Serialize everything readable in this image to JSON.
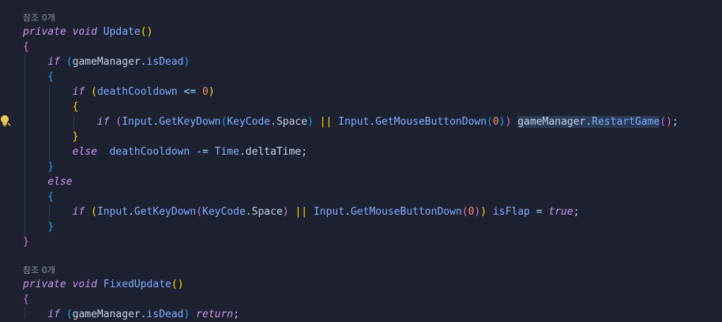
{
  "editor": {
    "references": [
      "참조 0개",
      "참조 0개"
    ],
    "tokens": {
      "private": "private",
      "void": "void",
      "if": "if",
      "else": "else",
      "return": "return",
      "true": "true",
      "update": "Update",
      "fixed_update": "FixedUpdate",
      "game_manager": "gameManager",
      "is_dead": "isDead",
      "death_cooldown": "deathCooldown",
      "input": "Input",
      "get_key_down": "GetKeyDown",
      "key_code": "KeyCode",
      "space": "Space",
      "get_mouse_button_down": "GetMouseButtonDown",
      "restart_game": "RestartGame",
      "time": "Time",
      "delta_time": "deltaTime",
      "is_flap": "isFlap",
      "zero": "0",
      "dot": ".",
      "semicolon": ";",
      "lparen": "(",
      "rparen": ")",
      "lbrace": "{",
      "rbrace": "}",
      "lte": "<=",
      "minus_eq": "-=",
      "or": "||",
      "eq": "="
    },
    "lightbulb_icon": "lightbulb-icon",
    "colors": {
      "background": "#1e2230",
      "keyword": "#c792ea",
      "function": "#82aaff",
      "number": "#f78c6c",
      "bracket_gold": "#ffd700",
      "bracket_purple": "#da70d6",
      "bracket_blue": "#179fff"
    }
  }
}
